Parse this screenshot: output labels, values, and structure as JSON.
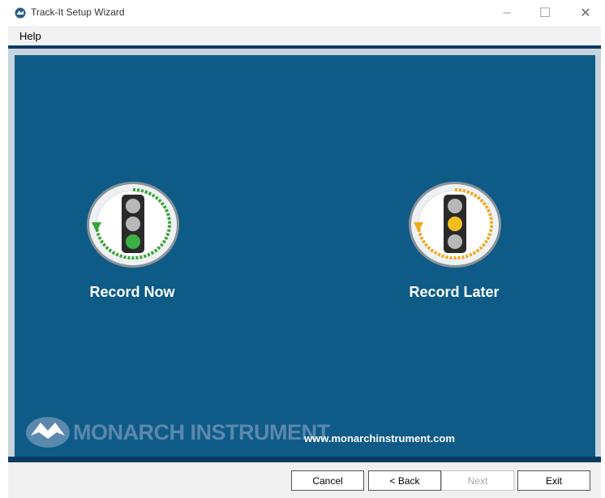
{
  "window": {
    "title": "Track-It Setup Wizard",
    "controls": [
      "–",
      "☐",
      "✕"
    ]
  },
  "menu": {
    "items": [
      {
        "label": "Help"
      }
    ]
  },
  "main": {
    "record_now": {
      "label": "Record Now",
      "light": "green",
      "accent_color": "#3aa336"
    },
    "record_later": {
      "label": "Record Later",
      "light": "yellow",
      "accent_color": "#f0a918"
    }
  },
  "brand": {
    "name": "MONARCH INSTRUMENT",
    "website": "www.monarchinstrument.com"
  },
  "buttons": {
    "cancel": "Cancel",
    "back": "< Back",
    "next": "Next",
    "exit": "Exit"
  },
  "colors": {
    "panel": "#0e5b87",
    "frame": "#0b3a63"
  }
}
